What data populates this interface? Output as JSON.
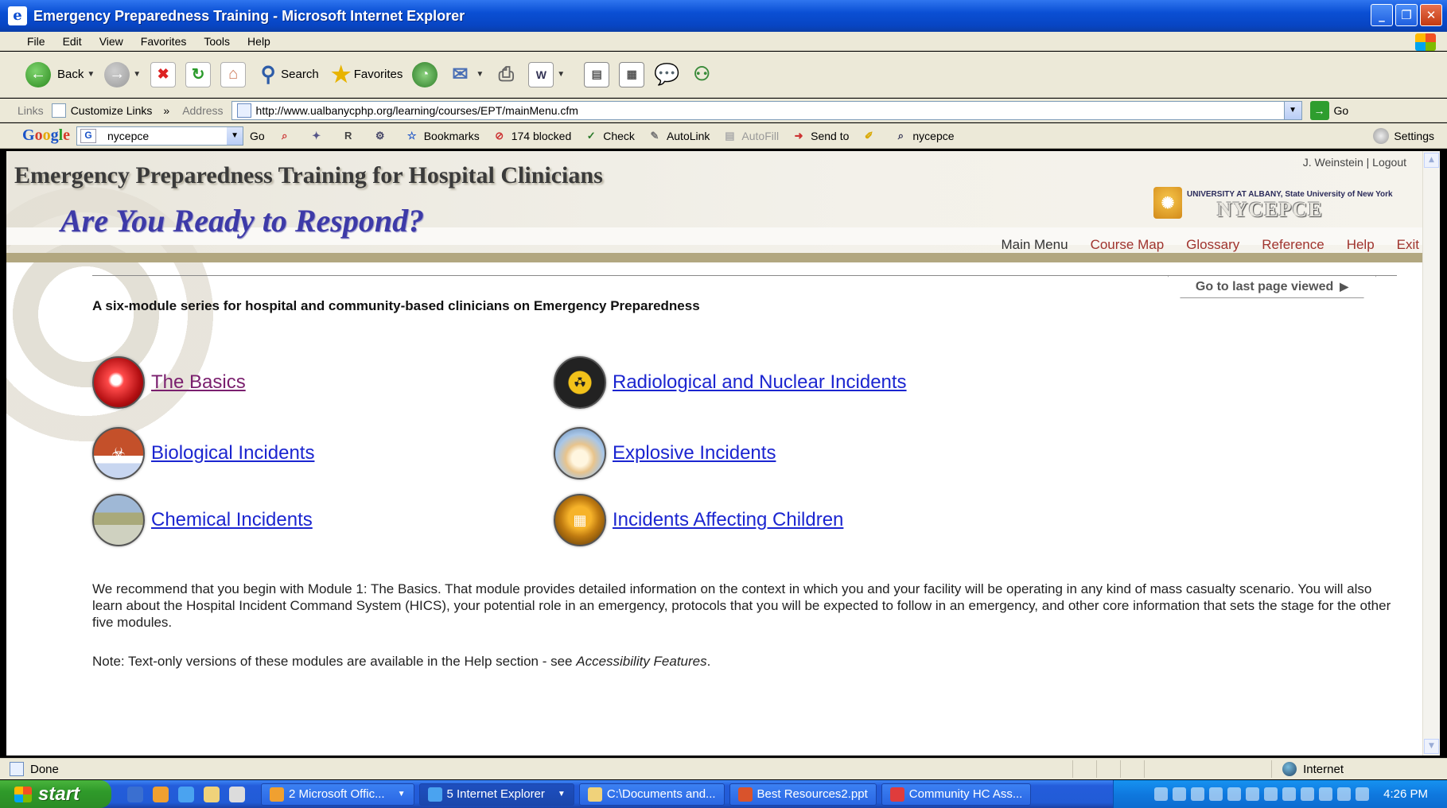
{
  "window": {
    "title": "Emergency Preparedness Training - Microsoft Internet Explorer",
    "min_glyph": "_",
    "max_glyph": "❐",
    "close_glyph": "✕"
  },
  "menu": [
    "File",
    "Edit",
    "View",
    "Favorites",
    "Tools",
    "Help"
  ],
  "toolbar": {
    "back": "Back",
    "search": "Search",
    "favorites": "Favorites"
  },
  "addressbar": {
    "links_label": "Links",
    "customize_links": "Customize Links",
    "more_glyph": "»",
    "address_label": "Address",
    "url": "http://www.ualbanycphp.org/learning/courses/EPT/mainMenu.cfm",
    "go": "Go"
  },
  "google_toolbar": {
    "logo": [
      "G",
      "o",
      "o",
      "g",
      "l",
      "e"
    ],
    "search_value": "nycepce",
    "go": "Go",
    "bookmarks": "Bookmarks",
    "blocked": "174 blocked",
    "check": "Check",
    "autolink": "AutoLink",
    "autofill": "AutoFill",
    "send_to": "Send to",
    "highlight_term": "nycepce",
    "settings": "Settings"
  },
  "page": {
    "user_links": "J. Weinstein | Logout",
    "heading": "Emergency Preparedness Training for Hospital Clinicians",
    "tagline": "Are You Ready to Respond?",
    "logo_university": "UNIVERSITY AT ALBANY, State University of New York",
    "logo_name": "NYCEPCE",
    "nav": [
      "Main Menu",
      "Course Map",
      "Glossary",
      "Reference",
      "Help",
      "Exit"
    ],
    "last_page": "Go to last page viewed",
    "intro": "A six-module series for hospital and community-based clinicians on Emergency Preparedness",
    "modules": [
      {
        "label": "The Basics",
        "icon": "basics-icon",
        "visited": true
      },
      {
        "label": "Radiological and Nuclear Incidents",
        "icon": "radiation-icon",
        "visited": false
      },
      {
        "label": "Biological Incidents",
        "icon": "biohazard-icon",
        "visited": false
      },
      {
        "label": "Explosive Incidents",
        "icon": "explosion-icon",
        "visited": false
      },
      {
        "label": "Chemical Incidents",
        "icon": "chemical-icon",
        "visited": false
      },
      {
        "label": "Incidents Affecting Children",
        "icon": "school-bus-icon",
        "visited": false
      }
    ],
    "recommend": "We recommend that you begin with Module 1: The Basics. That module provides detailed information on the context in which you and your facility will be operating in any kind of mass casualty scenario. You will also learn about the Hospital Incident Command System (HICS), your potential role in an emergency, protocols that you will be expected to follow in an emergency, and other core information that sets the stage for the other five modules.",
    "note_prefix": "Note: Text-only versions of these modules are available in the Help section - see ",
    "note_link": "Accessibility Features",
    "note_suffix": "."
  },
  "status": {
    "text": "Done",
    "zone": "Internet"
  },
  "taskbar": {
    "start": "start",
    "tasks": [
      "2 Microsoft Offic...",
      "5 Internet Explorer",
      "C:\\Documents and...",
      "Best Resources2.ppt",
      "Community HC Ass..."
    ],
    "clock": "4:26 PM"
  },
  "colors": {
    "link": "#1b25d0",
    "visited_link": "#7a1f6e",
    "nav": "#a0342e",
    "tagline": "#3d3aa8",
    "gold_bar": "#b2a780"
  }
}
